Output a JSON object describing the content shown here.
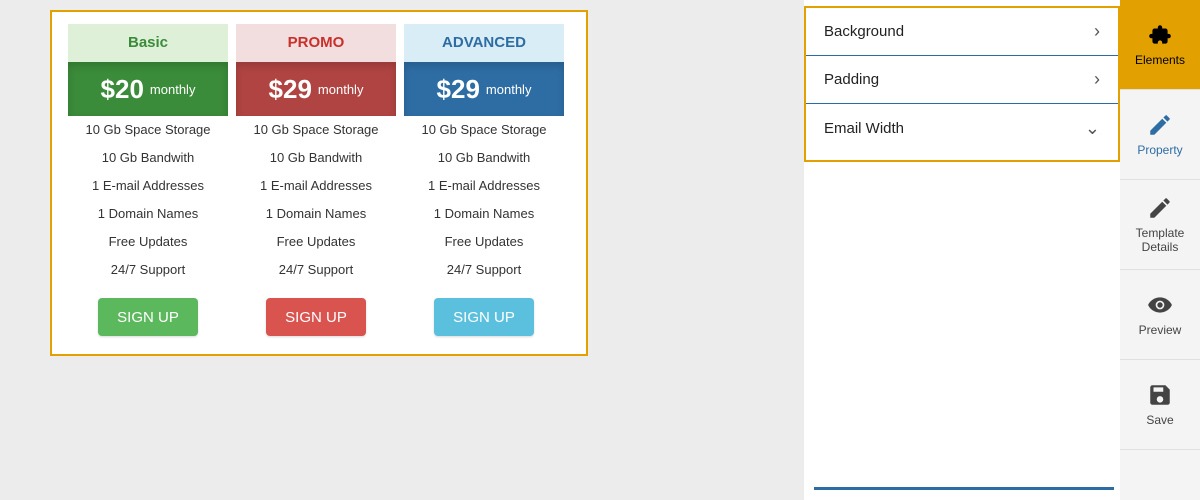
{
  "pricing": {
    "plans": [
      {
        "key": "basic",
        "name": "Basic",
        "price": "$20",
        "period": "monthly",
        "cta": "SIGN UP",
        "features": [
          "10 Gb Space Storage",
          "10 Gb Bandwith",
          "1 E-mail Addresses",
          "1 Domain Names",
          "Free Updates",
          "24/7 Support"
        ]
      },
      {
        "key": "promo",
        "name": "PROMO",
        "price": "$29",
        "period": "monthly",
        "cta": "SIGN UP",
        "features": [
          "10 Gb Space Storage",
          "10 Gb Bandwith",
          "1 E-mail Addresses",
          "1 Domain Names",
          "Free Updates",
          "24/7 Support"
        ]
      },
      {
        "key": "advanced",
        "name": "ADVANCED",
        "price": "$29",
        "period": "monthly",
        "cta": "SIGN UP",
        "features": [
          "10 Gb Space Storage",
          "10 Gb Bandwith",
          "1 E-mail Addresses",
          "1 Domain Names",
          "Free Updates",
          "24/7 Support"
        ]
      }
    ]
  },
  "properties": {
    "rows": [
      {
        "label": "Background",
        "chevron": "right"
      },
      {
        "label": "Padding",
        "chevron": "right"
      },
      {
        "label": "Email Width",
        "chevron": "down"
      }
    ]
  },
  "tools": [
    {
      "key": "elements",
      "label": "Elements",
      "icon": "puzzle-icon"
    },
    {
      "key": "property",
      "label": "Property",
      "icon": "pencil-icon"
    },
    {
      "key": "template",
      "label": "Template Details",
      "icon": "pencil-icon"
    },
    {
      "key": "preview",
      "label": "Preview",
      "icon": "eye-icon"
    },
    {
      "key": "save",
      "label": "Save",
      "icon": "floppy-icon"
    }
  ]
}
